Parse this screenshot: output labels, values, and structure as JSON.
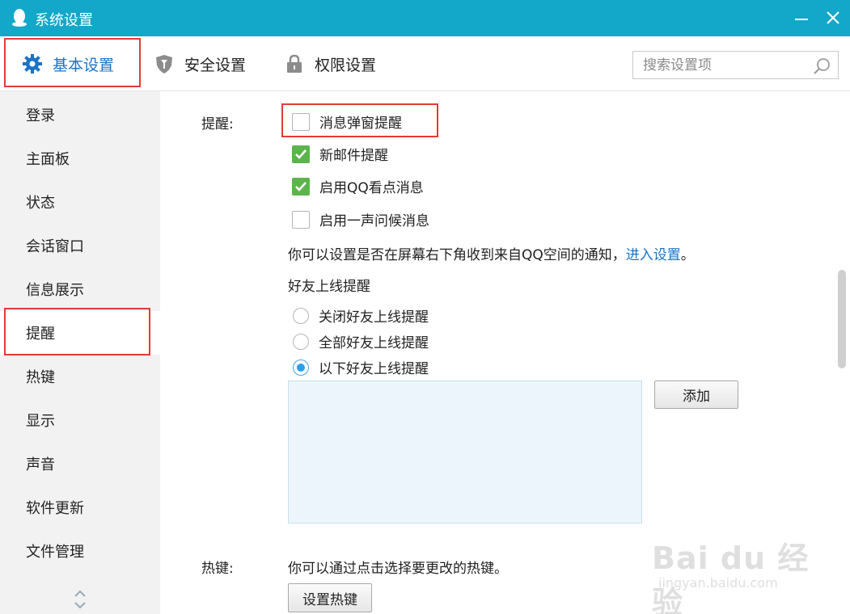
{
  "window": {
    "title": "系统设置",
    "title_bar_color": "#13a7c9"
  },
  "top_nav": {
    "tabs": [
      {
        "label": "基本设置",
        "icon": "gear-icon",
        "active": true
      },
      {
        "label": "安全设置",
        "icon": "shield-icon",
        "active": false
      },
      {
        "label": "权限设置",
        "icon": "lock-icon",
        "active": false
      }
    ],
    "search_placeholder": "搜索设置项",
    "accent_color": "#1a73c6"
  },
  "sidebar": {
    "items": [
      {
        "label": "登录"
      },
      {
        "label": "主面板"
      },
      {
        "label": "状态"
      },
      {
        "label": "会话窗口"
      },
      {
        "label": "信息展示"
      },
      {
        "label": "提醒",
        "active": true
      },
      {
        "label": "热键"
      },
      {
        "label": "显示"
      },
      {
        "label": "声音"
      },
      {
        "label": "软件更新"
      },
      {
        "label": "文件管理"
      }
    ]
  },
  "reminder": {
    "section_label": "提醒:",
    "checkboxes": [
      {
        "label": "消息弹窗提醒",
        "checked": false
      },
      {
        "label": "新邮件提醒",
        "checked": true
      },
      {
        "label": "启用QQ看点消息",
        "checked": true
      },
      {
        "label": "启用一声问候消息",
        "checked": false
      }
    ],
    "notice_text": "你可以设置是否在屏幕右下角收到来自QQ空间的通知，",
    "notice_link": "进入设置",
    "notice_end": "。",
    "friend_online_title": "好友上线提醒",
    "radios": [
      {
        "label": "关闭好友上线提醒",
        "checked": false
      },
      {
        "label": "全部好友上线提醒",
        "checked": false
      },
      {
        "label": "以下好友上线提醒",
        "checked": true
      }
    ],
    "add_button": "添加"
  },
  "hotkey": {
    "section_label": "热键:",
    "description": "你可以通过点击选择要更改的热键。",
    "button": "设置热键"
  },
  "watermark": {
    "brand": "Bai du 经验",
    "url": "jingyan.baidu.com"
  },
  "colors": {
    "highlight_red": "#e53935",
    "checkbox_green": "#5bb54a",
    "radio_blue": "#29a0e8",
    "link_blue": "#1a73c6"
  }
}
